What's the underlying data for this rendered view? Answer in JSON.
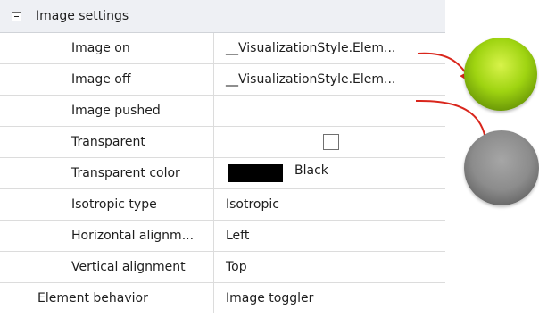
{
  "property_grid": {
    "group": {
      "label": "Image settings",
      "expanded": true
    },
    "rows": [
      {
        "name": "Image on",
        "value": "__VisualizationStyle.Elem..."
      },
      {
        "name": "Image off",
        "value": "__VisualizationStyle.Elem..."
      },
      {
        "name": "Image pushed",
        "value": ""
      },
      {
        "name": "Transparent",
        "checked": false
      },
      {
        "name": "Transparent color",
        "value": "Black",
        "swatch_color": "#000000"
      },
      {
        "name": "Isotropic type",
        "value": "Isotropic"
      },
      {
        "name": "Horizontal alignm...",
        "value": "Left"
      },
      {
        "name": "Vertical alignment",
        "value": "Top"
      },
      {
        "name": "Element behavior",
        "value": "Image toggler"
      }
    ]
  },
  "preview": {
    "image_on_color": "#9fd411",
    "image_off_color": "#8c8c8c",
    "arrow_color": "#d9261c"
  }
}
